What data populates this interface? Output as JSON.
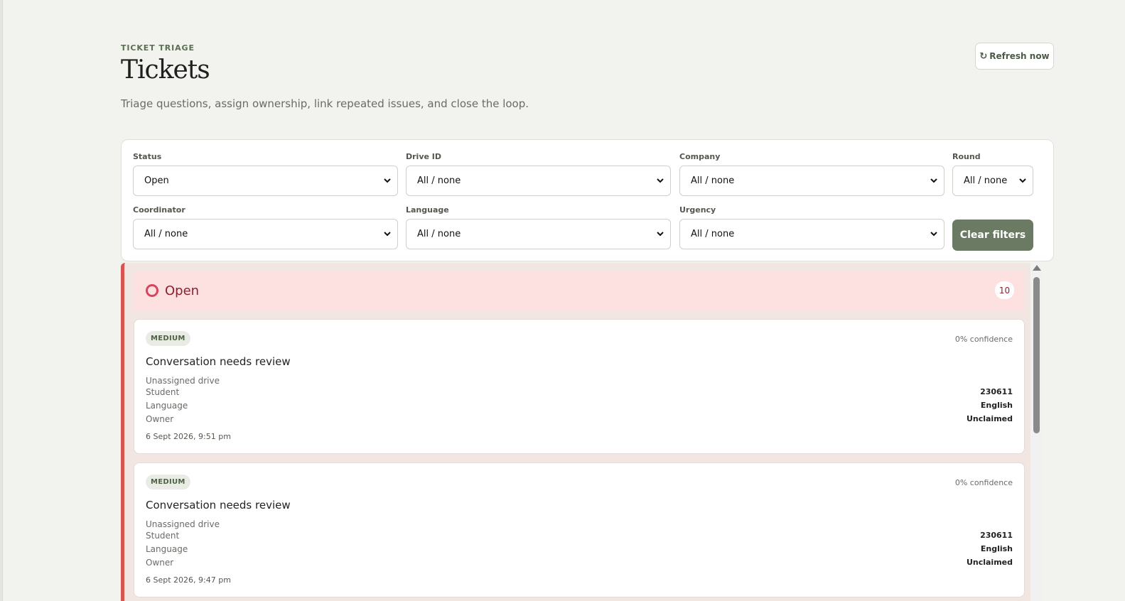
{
  "header": {
    "eyebrow": "TICKET TRIAGE",
    "title": "Tickets",
    "subtitle": "Triage questions, assign ownership, link repeated issues, and close the loop.",
    "refresh_icon": "↻",
    "refresh_label": "Refresh now"
  },
  "filters": {
    "status": {
      "label": "Status",
      "value": "Open"
    },
    "drive_id": {
      "label": "Drive ID",
      "value": "All / none"
    },
    "company": {
      "label": "Company",
      "value": "All / none"
    },
    "round": {
      "label": "Round",
      "value": "All / none"
    },
    "coordinator": {
      "label": "Coordinator",
      "value": "All / none"
    },
    "language": {
      "label": "Language",
      "value": "All / none"
    },
    "urgency": {
      "label": "Urgency",
      "value": "All / none"
    },
    "clear_label": "Clear filters"
  },
  "column": {
    "title": "Open",
    "count": "10",
    "accent_color": "#d9534f",
    "tickets": [
      {
        "urgency": "MEDIUM",
        "confidence": "0% confidence",
        "title": "Conversation needs review",
        "drive": "Unassigned drive",
        "student_label": "Student",
        "student_value": "230611",
        "language_label": "Language",
        "language_value": "English",
        "owner_label": "Owner",
        "owner_value": "Unclaimed",
        "timestamp": "6 Sept 2026, 9:51 pm"
      },
      {
        "urgency": "MEDIUM",
        "confidence": "0% confidence",
        "title": "Conversation needs review",
        "drive": "Unassigned drive",
        "student_label": "Student",
        "student_value": "230611",
        "language_label": "Language",
        "language_value": "English",
        "owner_label": "Owner",
        "owner_value": "Unclaimed",
        "timestamp": "6 Sept 2026, 9:47 pm"
      }
    ]
  },
  "colors": {
    "accent_green": "#6b7a62",
    "open_red": "#d6455d",
    "background": "#f2f3ef"
  }
}
